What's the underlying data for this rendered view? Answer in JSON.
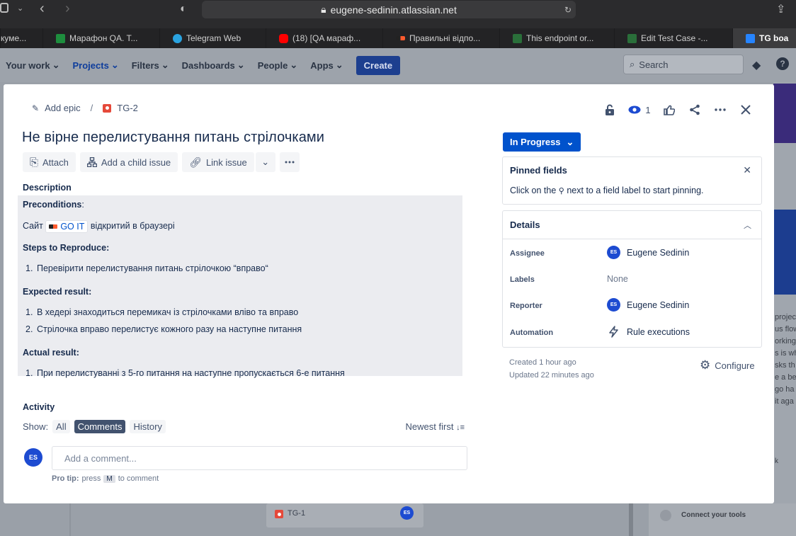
{
  "browser": {
    "url": "eugene-sedinin.atlassian.net",
    "tabs": [
      {
        "label": "кyме...",
        "color": "#2b2b2d"
      },
      {
        "label": "Марафон QA. T...",
        "color": "#1e8e3e"
      },
      {
        "label": "Telegram Web",
        "color": "#2aa3e0"
      },
      {
        "label": "(18) [QA мараф...",
        "color": "#ff0000"
      },
      {
        "label": "Правильні відпо...",
        "color": "#ff5b2e"
      },
      {
        "label": "This endpoint or...",
        "color": "#2a6f3a"
      },
      {
        "label": "Edit Test Case -...",
        "color": "#2a6f3a"
      },
      {
        "label": "TG boa",
        "color": "#2684ff"
      }
    ]
  },
  "nav": {
    "items": [
      "Your work",
      "Projects",
      "Filters",
      "Dashboards",
      "People",
      "Apps"
    ],
    "create": "Create",
    "search_placeholder": "Search"
  },
  "background": {
    "right_text": [
      "projec",
      "us flow",
      "orking",
      "s is wh",
      "sks th",
      "e a be",
      "go ha",
      "it aga"
    ],
    "right_item": "k",
    "card_key": "TG-1",
    "card_avatar": "ES",
    "connect": "Connect your tools"
  },
  "issue": {
    "breadcrumb": {
      "add_epic": "Add epic",
      "separator": "/",
      "key": "TG-2"
    },
    "watch_count": "1",
    "title": "Не вірне перелистування питань стрілочками",
    "toolbar": {
      "attach": "Attach",
      "child": "Add a child issue",
      "link": "Link issue"
    },
    "description_label": "Description",
    "description": {
      "preconditions_label": "Preconditions",
      "preconditions_colon": ":",
      "site_prefix": "Сайт",
      "site_link": "GO IT",
      "site_suffix": "відкритий в браузері",
      "steps_label": "Steps to Reproduce:",
      "steps": [
        "Перевірити перелистування питань стрілочкою “вправо“"
      ],
      "expected_label": "Expected result:",
      "expected": [
        "В хедері знаходиться перемикач із стрілочками вліво та вправо",
        "Стрілочка вправо перелистує кожного разу на наступне питання"
      ],
      "actual_label": "Actual result:",
      "actual": [
        "При перелистуванні з 5-го питання на наступне пропускається 6-е питання"
      ]
    },
    "activity": {
      "label": "Activity",
      "show": "Show:",
      "filters": [
        "All",
        "Comments",
        "History"
      ],
      "sort": "Newest first",
      "avatar": "ES",
      "comment_placeholder": "Add a comment...",
      "protip_label": "Pro tip:",
      "protip_press": "press",
      "protip_key": "M",
      "protip_suffix": "to comment"
    },
    "status": "In Progress",
    "pinned": {
      "title": "Pinned fields",
      "text_before": "Click on the",
      "text_after": "next to a field label to start pinning."
    },
    "details": {
      "title": "Details",
      "assignee_label": "Assignee",
      "assignee": "Eugene Sedinin",
      "labels_label": "Labels",
      "labels": "None",
      "reporter_label": "Reporter",
      "reporter": "Eugene Sedinin",
      "automation_label": "Automation",
      "automation": "Rule executions",
      "avatar": "ES"
    },
    "created": "Created 1 hour ago",
    "updated": "Updated 22 minutes ago",
    "configure": "Configure"
  }
}
